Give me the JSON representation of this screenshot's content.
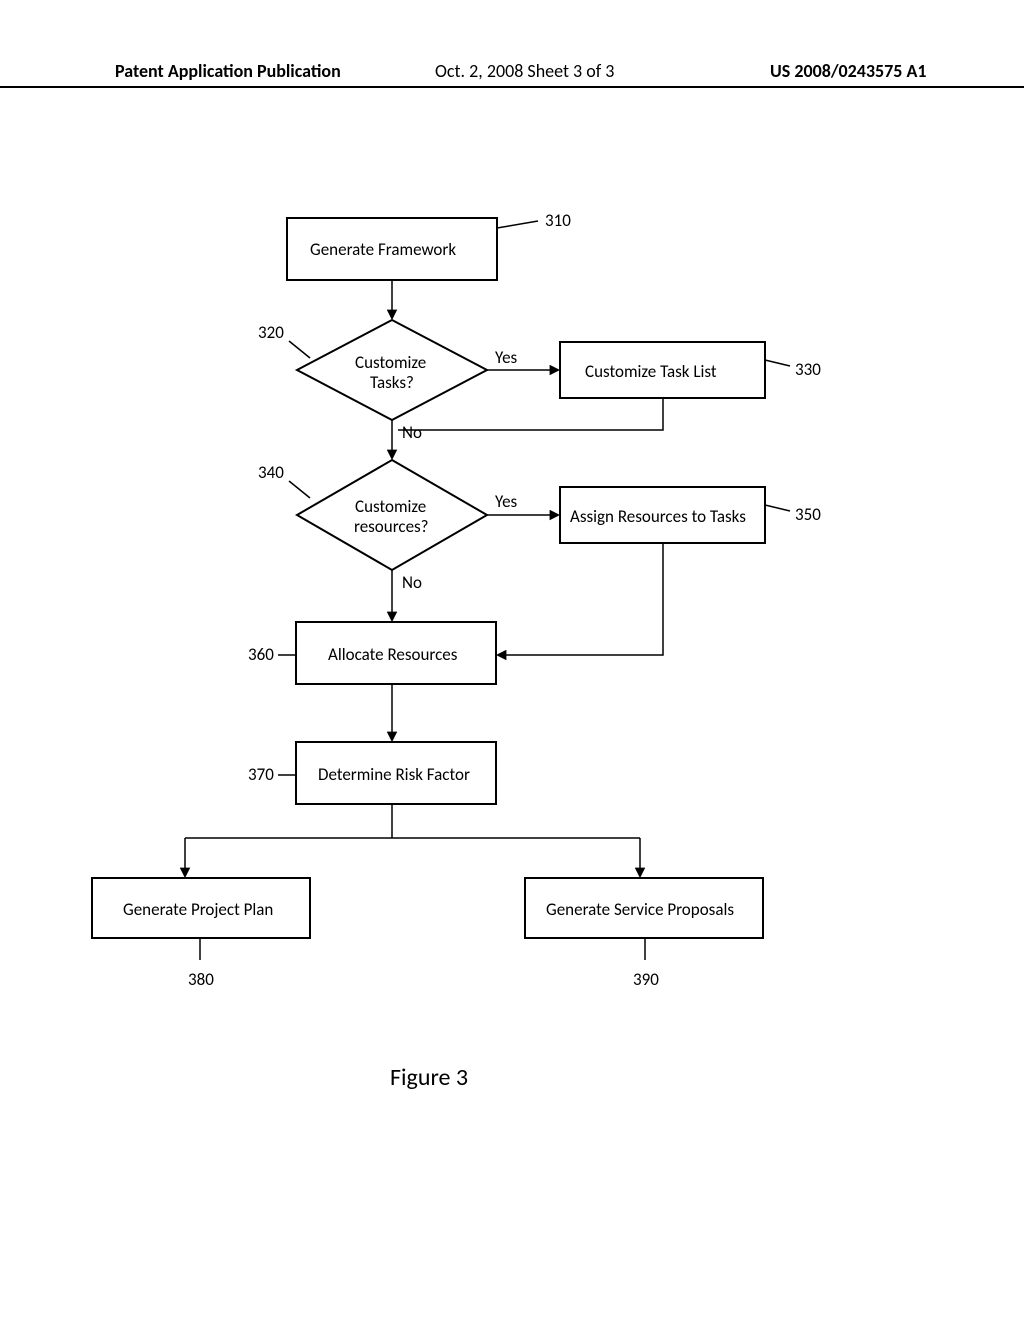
{
  "header": {
    "left": "Patent Application Publication",
    "mid": "Oct. 2, 2008  Sheet 3 of 3",
    "right": "US 2008/0243575 A1"
  },
  "figure_label": "Figure 3",
  "nodes": {
    "n310": {
      "ref": "310",
      "text": "Generate Framework"
    },
    "n320": {
      "ref": "320",
      "text1": "Customize",
      "text2": "Tasks?"
    },
    "n330": {
      "ref": "330",
      "text": "Customize Task List"
    },
    "n340": {
      "ref": "340",
      "text1": "Customize",
      "text2": "resources?"
    },
    "n350": {
      "ref": "350",
      "text": "Assign Resources to Tasks"
    },
    "n360": {
      "ref": "360",
      "text": "Allocate Resources"
    },
    "n370": {
      "ref": "370",
      "text": "Determine Risk Factor"
    },
    "n380": {
      "ref": "380",
      "text": "Generate Project Plan"
    },
    "n390": {
      "ref": "390",
      "text": "Generate Service Proposals"
    }
  },
  "labels": {
    "yes": "Yes",
    "no": "No"
  }
}
